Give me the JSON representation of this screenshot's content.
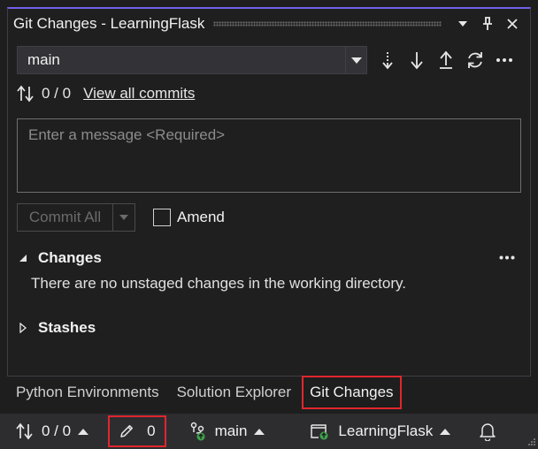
{
  "window": {
    "title": "Git Changes - LearningFlask"
  },
  "branch": {
    "current": "main"
  },
  "commits": {
    "count": "0 / 0",
    "view_all_label": "View all commits"
  },
  "message": {
    "placeholder": "Enter a message <Required>"
  },
  "commit": {
    "commit_all_label": "Commit All",
    "amend_label": "Amend"
  },
  "changes": {
    "title": "Changes",
    "empty_text": "There are no unstaged changes in the working directory."
  },
  "stashes": {
    "title": "Stashes"
  },
  "tabs": [
    {
      "label": "Python Environments"
    },
    {
      "label": "Solution Explorer"
    },
    {
      "label": "Git Changes"
    }
  ],
  "status_bar": {
    "sync_count": "0 / 0",
    "pending_changes": "0",
    "branch": "main",
    "repo": "LearningFlask"
  },
  "colors": {
    "accent": "#7160e8",
    "highlight_box": "#e0262d",
    "repo_badge": "#3fa34d"
  }
}
